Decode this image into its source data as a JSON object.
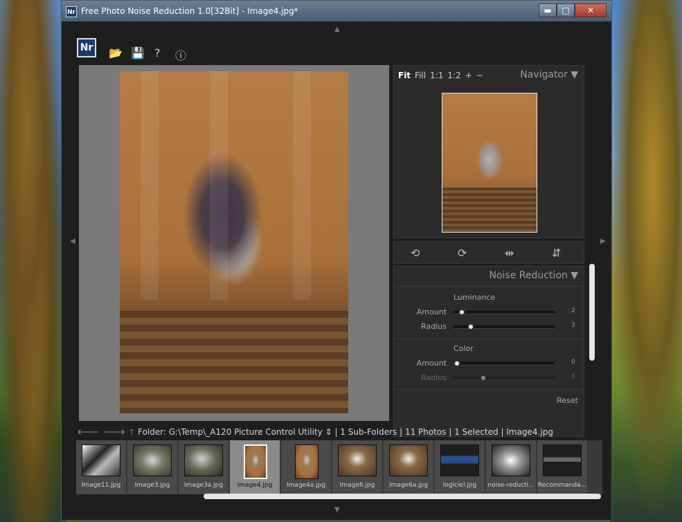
{
  "window": {
    "app_icon": "Nr",
    "title": "Free Photo Noise Reduction 1.0[32Bit] - Image4.jpg*",
    "controls": {
      "minimize": "▬",
      "maximize": "□",
      "close": "✕"
    }
  },
  "toolbar": {
    "logo": "Nr",
    "icons": [
      "folder-icon",
      "save-icon",
      "help-icon",
      "info-icon"
    ],
    "glyphs": {
      "open": "📂",
      "save": "💾",
      "help": "?",
      "info": "ⓘ"
    }
  },
  "navigator": {
    "zoom_options": [
      "Fit",
      "Fill",
      "1:1",
      "1:2",
      "+",
      "−"
    ],
    "active_zoom": "Fit",
    "title": "Navigator",
    "collapse": "▼"
  },
  "transform": {
    "icons": [
      "rotate-left-icon",
      "rotate-right-icon",
      "flip-horizontal-icon",
      "flip-vertical-icon"
    ],
    "glyphs": [
      "⟲",
      "⟳",
      "⇹",
      "⇵"
    ]
  },
  "noise_reduction": {
    "title": "Noise Reduction",
    "collapse": "▼",
    "luminance": {
      "title": "Luminance",
      "amount": {
        "label": "Amount",
        "value": "2",
        "fraction": 0.05
      },
      "radius": {
        "label": "Radius",
        "value": "3",
        "fraction": 0.15
      }
    },
    "color": {
      "title": "Color",
      "amount": {
        "label": "Amount",
        "value": "0",
        "fraction": 0.0
      },
      "radius": {
        "label": "Radius",
        "value": "6",
        "fraction": 0.28,
        "disabled": true
      }
    },
    "reset": "Reset"
  },
  "folder_bar": {
    "nav_icons": [
      "back-arrow-icon",
      "forward-arrow-icon",
      "up-arrow-icon"
    ],
    "nav_glyphs": [
      "🡐",
      "🡒",
      "🡑"
    ],
    "label": "Folder:",
    "path": "G:\\Temp\\_A120 Picture Control Utility ⇕",
    "info": "| 1 Sub-Folders | 11 Photos | 1 Selected | Image4.jpg"
  },
  "filmstrip": {
    "items": [
      {
        "label": "Image11.jpg",
        "selected": false
      },
      {
        "label": "Image3.jpg",
        "selected": false
      },
      {
        "label": "Image3a.jpg",
        "selected": false
      },
      {
        "label": "Image4.jpg",
        "selected": true
      },
      {
        "label": "Image4a.jpg",
        "selected": false
      },
      {
        "label": "Image6.jpg",
        "selected": false
      },
      {
        "label": "Image6a.jpg",
        "selected": false
      },
      {
        "label": "logiciel.jpg",
        "selected": false
      },
      {
        "label": "noise-reducti...",
        "selected": false
      },
      {
        "label": "Recommanda...",
        "selected": false
      }
    ]
  },
  "colors": {
    "window_bg": "#1e1e1e",
    "panel_bg": "#2b2b2b",
    "accent_logo": "#1b3a6b",
    "viewer_bg": "#7a7a7a"
  }
}
